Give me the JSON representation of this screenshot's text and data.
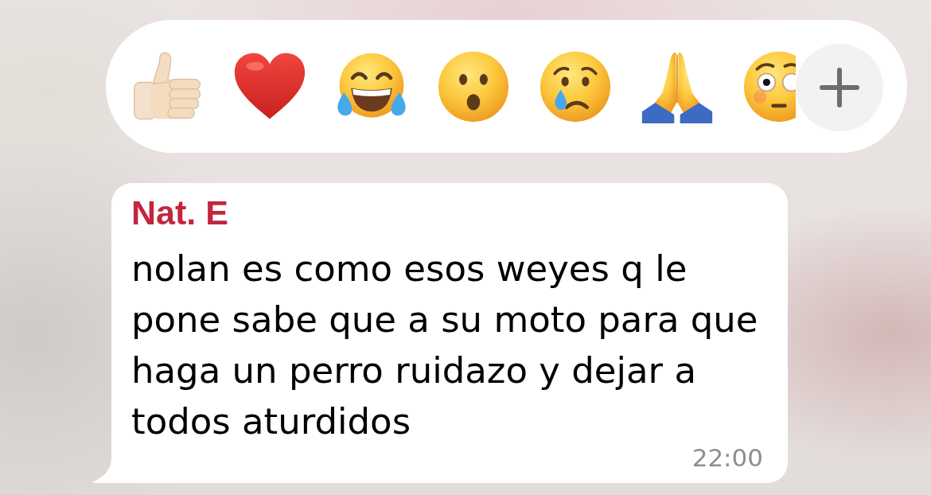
{
  "reaction_bar": {
    "reactions": [
      {
        "kind": "thumbs_up"
      },
      {
        "kind": "heart"
      },
      {
        "kind": "tears_of_joy"
      },
      {
        "kind": "surprised"
      },
      {
        "kind": "crying"
      },
      {
        "kind": "folded_hands"
      },
      {
        "kind": "flushed"
      }
    ]
  },
  "message": {
    "sender": "Nat. E",
    "text": "nolan es como esos weyes q le pone sabe que a su moto para que haga un perro ruidazo y dejar a todos aturdidos",
    "time": "22:00"
  }
}
